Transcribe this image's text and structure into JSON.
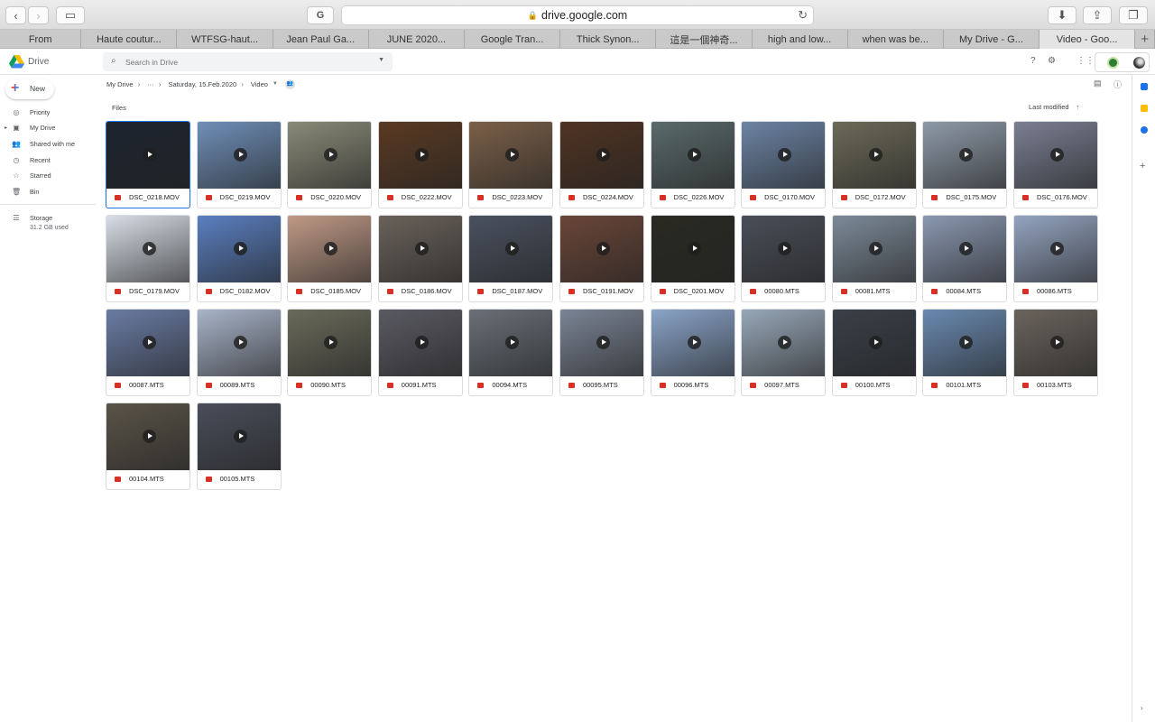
{
  "browser": {
    "url": "drive.google.com",
    "tabs": [
      {
        "label": "From",
        "width": 91
      },
      {
        "label": "Haute coutur...",
        "width": 107
      },
      {
        "label": "WTFSG-haut...",
        "width": 107
      },
      {
        "label": "Jean Paul Ga...",
        "width": 107
      },
      {
        "label": "JUNE 2020...",
        "width": 107
      },
      {
        "label": "Google Tran...",
        "width": 107
      },
      {
        "label": "Thick Synon...",
        "width": 107
      },
      {
        "label": "這是一個神奇...",
        "width": 107
      },
      {
        "label": "high and low...",
        "width": 107
      },
      {
        "label": "when was be...",
        "width": 107
      },
      {
        "label": "My Drive - G...",
        "width": 107
      },
      {
        "label": "Video - Goo...",
        "width": 107,
        "active": true
      }
    ]
  },
  "drive": {
    "app_name": "Drive",
    "search_placeholder": "Search in Drive",
    "new_label": "New",
    "nav": [
      {
        "label": "Priority",
        "icon": "check-circle-icon"
      },
      {
        "label": "My Drive",
        "icon": "drive-icon"
      },
      {
        "label": "Shared with me",
        "icon": "people-icon"
      },
      {
        "label": "Recent",
        "icon": "clock-icon"
      },
      {
        "label": "Starred",
        "icon": "star-icon"
      },
      {
        "label": "Bin",
        "icon": "trash-icon"
      }
    ],
    "storage_label": "Storage",
    "storage_used": "31.2 GB used",
    "breadcrumb": {
      "root": "My Drive",
      "ellipsis": "···",
      "folder1": "Saturday, 15.Feb.2020",
      "current": "Video"
    },
    "section_label": "Files",
    "sort_label": "Last modified",
    "files": [
      {
        "name": "DSC_0218.MOV",
        "bg": "#1d2430"
      },
      {
        "name": "DSC_0219.MOV",
        "bg": "#6f8fb8"
      },
      {
        "name": "DSC_0220.MOV",
        "bg": "#8a8a78"
      },
      {
        "name": "DSC_0222.MOV",
        "bg": "#5a3a22"
      },
      {
        "name": "DSC_0223.MOV",
        "bg": "#7b6048"
      },
      {
        "name": "DSC_0224.MOV",
        "bg": "#4f3322"
      },
      {
        "name": "DSC_0226.MOV",
        "bg": "#5a6a6a"
      },
      {
        "name": "DSC_0170.MOV",
        "bg": "#6c84a4"
      },
      {
        "name": "DSC_0172.MOV",
        "bg": "#6c6a58"
      },
      {
        "name": "DSC_0175.MOV",
        "bg": "#8e9aa8"
      },
      {
        "name": "DSC_0176.MOV",
        "bg": "#7a7f92"
      },
      {
        "name": "DSC_0179.MOV",
        "bg": "#d8dde6"
      },
      {
        "name": "DSC_0182.MOV",
        "bg": "#5a7fc0"
      },
      {
        "name": "DSC_0185.MOV",
        "bg": "#c09a86"
      },
      {
        "name": "DSC_0186.MOV",
        "bg": "#6a625a"
      },
      {
        "name": "DSC_0187.MOV",
        "bg": "#4a5260"
      },
      {
        "name": "DSC_0191.MOV",
        "bg": "#6a4638"
      },
      {
        "name": "DSC_0201.MOV",
        "bg": "#2a2a22"
      },
      {
        "name": "00080.MTS",
        "bg": "#4a4e58"
      },
      {
        "name": "00081.MTS",
        "bg": "#7c8a98"
      },
      {
        "name": "00084.MTS",
        "bg": "#8a98b0"
      },
      {
        "name": "00086.MTS",
        "bg": "#94a4c0"
      },
      {
        "name": "00087.MTS",
        "bg": "#6a7ca4"
      },
      {
        "name": "00089.MTS",
        "bg": "#a8b4c8"
      },
      {
        "name": "00090.MTS",
        "bg": "#6a6a5a"
      },
      {
        "name": "00091.MTS",
        "bg": "#5a5a62"
      },
      {
        "name": "00094.MTS",
        "bg": "#6a7078"
      },
      {
        "name": "00095.MTS",
        "bg": "#7a8494"
      },
      {
        "name": "00096.MTS",
        "bg": "#8aa4c8"
      },
      {
        "name": "00097.MTS",
        "bg": "#98a8b8"
      },
      {
        "name": "00100.MTS",
        "bg": "#3a4048"
      },
      {
        "name": "00101.MTS",
        "bg": "#6a8ab0"
      },
      {
        "name": "00103.MTS",
        "bg": "#6a645c"
      },
      {
        "name": "00104.MTS",
        "bg": "#5a5448"
      },
      {
        "name": "00105.MTS",
        "bg": "#4a4e5a"
      }
    ]
  }
}
